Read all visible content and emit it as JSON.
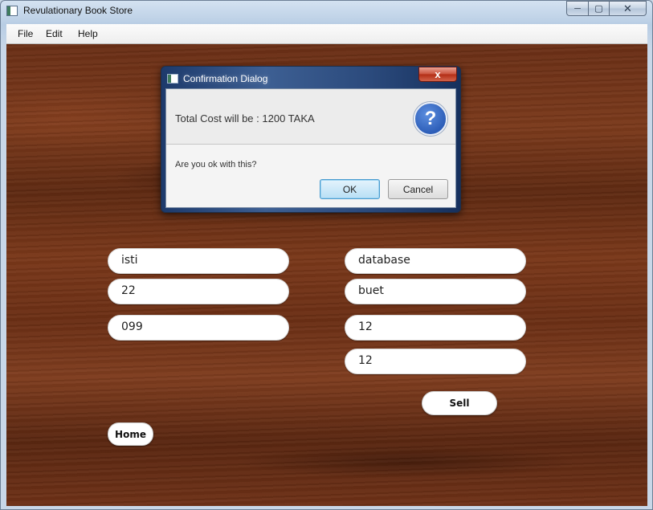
{
  "window": {
    "title": "Revulationary Book Store",
    "controls": {
      "minimize": "─",
      "maximize": "▢",
      "close": "✕"
    }
  },
  "menu": [
    "File",
    "Edit",
    "Help"
  ],
  "form": {
    "left_fields": [
      "isti",
      "22",
      "099"
    ],
    "right_fields": [
      "database",
      "buet",
      "12",
      "12"
    ],
    "sell_label": "Sell",
    "home_label": "Home"
  },
  "dialog": {
    "title": "Confirmation Dialog",
    "close": "x",
    "header_text": "Total Cost will be : 1200 TAKA",
    "icon": "question-icon",
    "icon_glyph": "?",
    "content_text": "Are you ok with this?",
    "ok_label": "OK",
    "cancel_label": "Cancel"
  }
}
